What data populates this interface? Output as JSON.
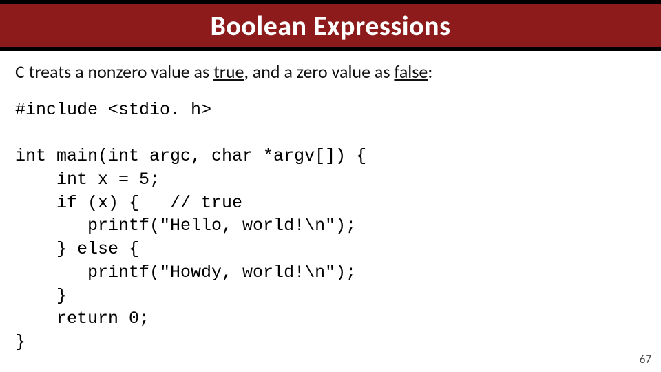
{
  "title": "Boolean Expressions",
  "intro": {
    "pre": "C treats a nonzero value as ",
    "true_word": "true",
    "mid": ", and a zero value as ",
    "false_word": "false",
    "post": ":"
  },
  "code": "#include <stdio. h>\n\nint main(int argc, char *argv[]) {\n    int x = 5;\n    if (x) {   // true\n       printf(\"Hello, world!\\n\");\n    } else {\n       printf(\"Howdy, world!\\n\");\n    }\n    return 0;\n}",
  "page_number": "67"
}
